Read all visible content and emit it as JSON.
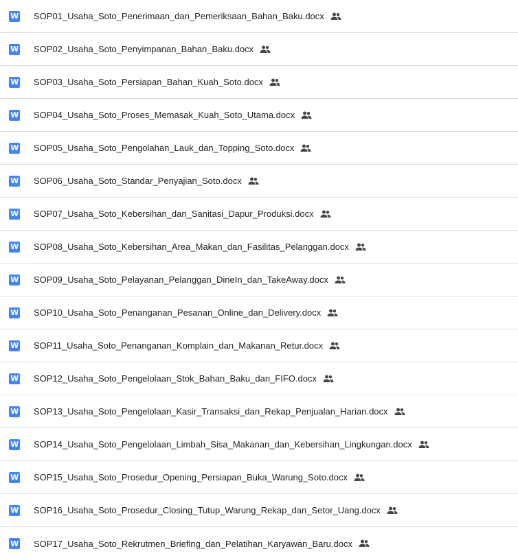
{
  "file_icon": {
    "name": "word-doc-icon",
    "glyph": "W",
    "color": "#4285f4"
  },
  "shared_icon": {
    "name": "shared-people-icon",
    "color": "#444746"
  },
  "files": [
    {
      "name": "SOP01_Usaha_Soto_Penerimaan_dan_Pemeriksaan_Bahan_Baku.docx",
      "shared": true
    },
    {
      "name": "SOP02_Usaha_Soto_Penyimpanan_Bahan_Baku.docx",
      "shared": true
    },
    {
      "name": "SOP03_Usaha_Soto_Persiapan_Bahan_Kuah_Soto.docx",
      "shared": true
    },
    {
      "name": "SOP04_Usaha_Soto_Proses_Memasak_Kuah_Soto_Utama.docx",
      "shared": true
    },
    {
      "name": "SOP05_Usaha_Soto_Pengolahan_Lauk_dan_Topping_Soto.docx",
      "shared": true
    },
    {
      "name": "SOP06_Usaha_Soto_Standar_Penyajian_Soto.docx",
      "shared": true
    },
    {
      "name": "SOP07_Usaha_Soto_Kebersihan_dan_Sanitasi_Dapur_Produksi.docx",
      "shared": true
    },
    {
      "name": "SOP08_Usaha_Soto_Kebersihan_Area_Makan_dan_Fasilitas_Pelanggan.docx",
      "shared": true
    },
    {
      "name": "SOP09_Usaha_Soto_Pelayanan_Pelanggan_DineIn_dan_TakeAway.docx",
      "shared": true
    },
    {
      "name": "SOP10_Usaha_Soto_Penanganan_Pesanan_Online_dan_Delivery.docx",
      "shared": true
    },
    {
      "name": "SOP11_Usaha_Soto_Penanganan_Komplain_dan_Makanan_Retur.docx",
      "shared": true
    },
    {
      "name": "SOP12_Usaha_Soto_Pengelolaan_Stok_Bahan_Baku_dan_FIFO.docx",
      "shared": true
    },
    {
      "name": "SOP13_Usaha_Soto_Pengelolaan_Kasir_Transaksi_dan_Rekap_Penjualan_Harian.docx",
      "shared": true
    },
    {
      "name": "SOP14_Usaha_Soto_Pengelolaan_Limbah_Sisa_Makanan_dan_Kebersihan_Lingkungan.docx",
      "shared": true
    },
    {
      "name": "SOP15_Usaha_Soto_Prosedur_Opening_Persiapan_Buka_Warung_Soto.docx",
      "shared": true
    },
    {
      "name": "SOP16_Usaha_Soto_Prosedur_Closing_Tutup_Warung_Rekap_dan_Setor_Uang.docx",
      "shared": true
    },
    {
      "name": "SOP17_Usaha_Soto_Rekrutmen_Briefing_dan_Pelatihan_Karyawan_Baru.docx",
      "shared": true
    }
  ]
}
